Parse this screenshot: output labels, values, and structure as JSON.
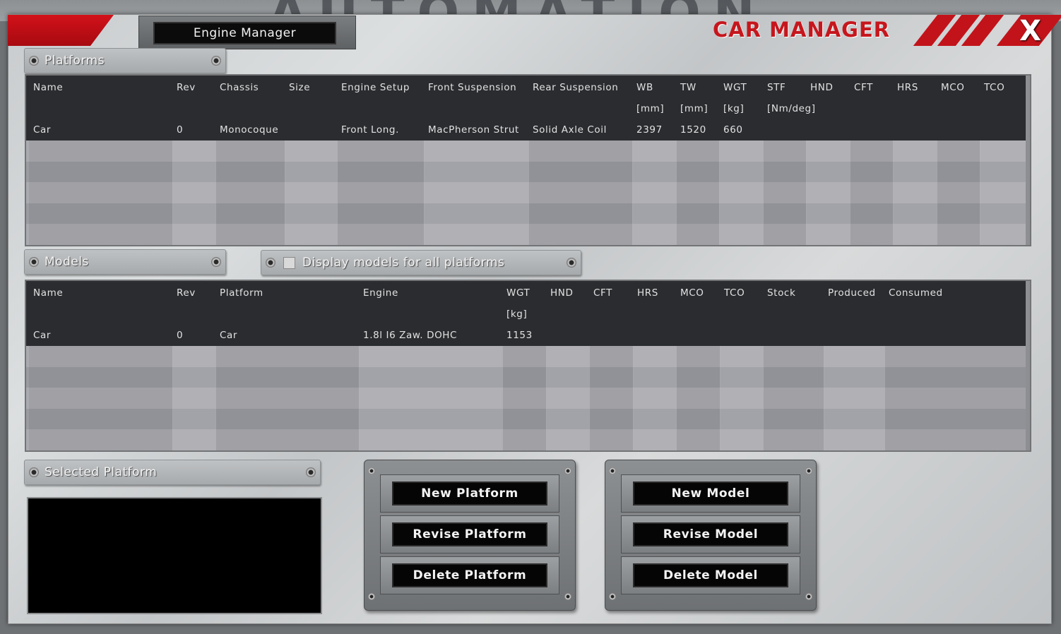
{
  "window": {
    "title": "CAR MANAGER",
    "close_label": "X",
    "background_text": "AUTOMATION"
  },
  "tabs": {
    "engine_manager": "Engine Manager"
  },
  "platforms": {
    "section_label": "Platforms",
    "columns": [
      {
        "label": "Name",
        "unit": ""
      },
      {
        "label": "Rev",
        "unit": ""
      },
      {
        "label": "Chassis",
        "unit": ""
      },
      {
        "label": "Size",
        "unit": ""
      },
      {
        "label": "Engine Setup",
        "unit": ""
      },
      {
        "label": "Front Suspension",
        "unit": ""
      },
      {
        "label": "Rear Suspension",
        "unit": ""
      },
      {
        "label": "WB",
        "unit": "[mm]"
      },
      {
        "label": "TW",
        "unit": "[mm]"
      },
      {
        "label": "WGT",
        "unit": "[kg]"
      },
      {
        "label": "STF",
        "unit": "[Nm/deg]"
      },
      {
        "label": "HND",
        "unit": ""
      },
      {
        "label": "CFT",
        "unit": ""
      },
      {
        "label": "HRS",
        "unit": ""
      },
      {
        "label": "MCO",
        "unit": ""
      },
      {
        "label": "TCO",
        "unit": ""
      }
    ],
    "rows": [
      [
        "Car",
        "0",
        "Monocoque",
        "",
        "Front Long.",
        "MacPherson Strut",
        "Solid Axle Coil",
        "2397",
        "1520",
        "660",
        "",
        "",
        "",
        "",
        "",
        ""
      ]
    ]
  },
  "models": {
    "section_label": "Models",
    "display_all_label": "Display models for all platforms",
    "display_all_checked": false,
    "columns": [
      {
        "label": "Name",
        "unit": ""
      },
      {
        "label": "Rev",
        "unit": ""
      },
      {
        "label": "Platform",
        "unit": ""
      },
      {
        "label": "Engine",
        "unit": ""
      },
      {
        "label": "WGT",
        "unit": "[kg]"
      },
      {
        "label": "HND",
        "unit": ""
      },
      {
        "label": "CFT",
        "unit": ""
      },
      {
        "label": "HRS",
        "unit": ""
      },
      {
        "label": "MCO",
        "unit": ""
      },
      {
        "label": "TCO",
        "unit": ""
      },
      {
        "label": "Stock",
        "unit": ""
      },
      {
        "label": "Produced",
        "unit": ""
      },
      {
        "label": "Consumed",
        "unit": ""
      }
    ],
    "rows": [
      [
        "Car",
        "0",
        "Car",
        "1.8l I6 Zaw. DOHC",
        "1153",
        "",
        "",
        "",
        "",
        "",
        "",
        "",
        ""
      ]
    ]
  },
  "selected_platform": {
    "section_label": "Selected Platform"
  },
  "platform_buttons": {
    "new": "New Platform",
    "revise": "Revise Platform",
    "delete": "Delete Platform"
  },
  "model_buttons": {
    "new": "New Model",
    "revise": "Revise Model",
    "delete": "Delete Model"
  },
  "colors": {
    "accent_red": "#c6161d",
    "grid_header": "#2a2c2f"
  }
}
